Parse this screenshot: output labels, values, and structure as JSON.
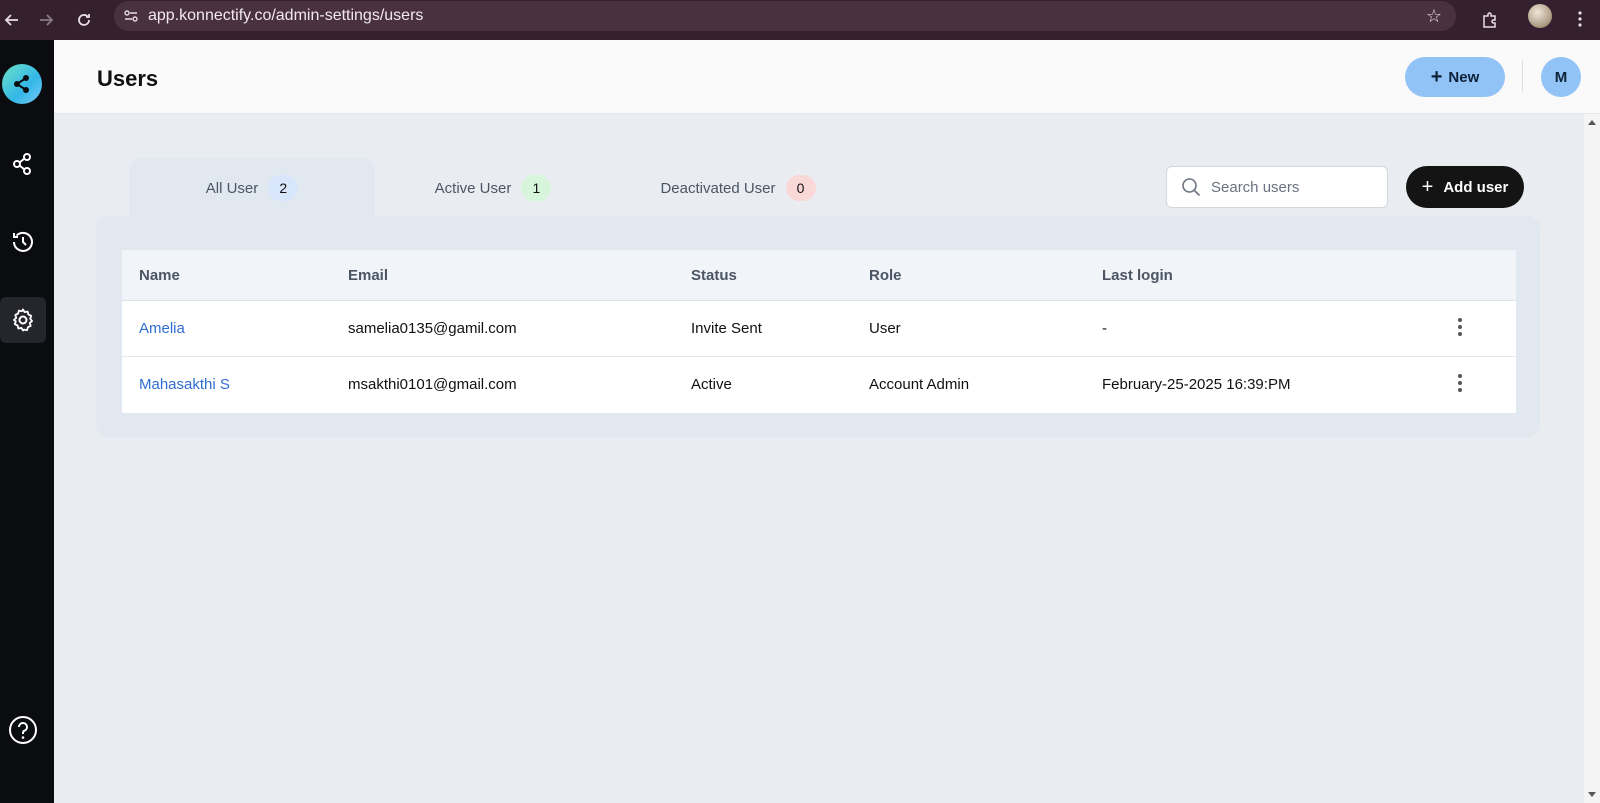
{
  "browser": {
    "url": "app.konnectify.co/admin-settings/users"
  },
  "header": {
    "title": "Users",
    "new_label": "New",
    "avatar_initial": "M"
  },
  "tabs": [
    {
      "label": "All User",
      "count": "2",
      "color": "#d7e6fb",
      "active": true
    },
    {
      "label": "Active User",
      "count": "1",
      "color": "#d6f5da",
      "active": false
    },
    {
      "label": "Deactivated User",
      "count": "0",
      "color": "#fbd8d8",
      "active": false
    }
  ],
  "search": {
    "placeholder": "Search users"
  },
  "add_user_label": "Add user",
  "table": {
    "columns": [
      "Name",
      "Email",
      "Status",
      "Role",
      "Last login"
    ],
    "rows": [
      {
        "name": "Amelia",
        "email": "samelia0135@gamil.com",
        "status": "Invite Sent",
        "role": "User",
        "last_login": "-"
      },
      {
        "name": "Mahasakthi S",
        "email": "msakthi0101@gmail.com",
        "status": "Active",
        "role": "Account Admin",
        "last_login": "February-25-2025 16:39:PM"
      }
    ]
  },
  "colors": {
    "accent": "#92c3f7",
    "link": "#2f6fd0",
    "sidebar": "#0b0c0f",
    "browser_bar": "#35202f"
  },
  "icons": {
    "sidebar": [
      "konnectify-logo-icon",
      "share-nodes-icon",
      "history-icon",
      "gear-icon",
      "help-circle-icon"
    ]
  }
}
